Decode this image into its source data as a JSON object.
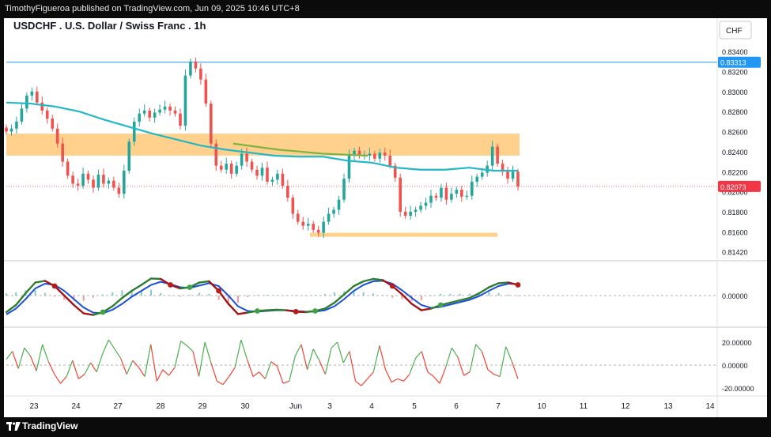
{
  "publisher_line": "TimothyFigueroa published on TradingView.com, Jun 09, 2025 10:46 UTC+8",
  "chart_title": "USDCHF . U.S. Dollar / Swiss Franc . 1h",
  "currency_button": "CHF",
  "brand": "TradingView",
  "colors": {
    "background": "#ffffff",
    "up_candle": "#26a69a",
    "down_candle": "#ef5350",
    "moving_average_teal": "#22b8c8",
    "moving_average_green": "#7cb342",
    "zone_fill": "#ffcc80",
    "horizontal_line": "#2196f3",
    "current_price_tag": "#f23645",
    "level_tag": "#2196f3",
    "fast_line": "#2e7d32",
    "slow_line": "#1e4fd8",
    "bearish_line": "#a31515",
    "oscillator_up": "#4caf50",
    "oscillator_down": "#f44336"
  },
  "chart_data": [
    {
      "type": "candlestick",
      "panel": "price",
      "title": "USDCHF . U.S. Dollar / Swiss Franc . 1h",
      "x": [
        "23",
        "24",
        "27",
        "28",
        "29",
        "30",
        "Jun",
        "3",
        "4",
        "5",
        "6",
        "7",
        "10",
        "11",
        "12",
        "13",
        "14"
      ],
      "y_ticks": [
        0.8342,
        0.8322,
        0.8302,
        0.8282,
        0.8262,
        0.8242,
        0.8222,
        0.8202,
        0.8182,
        0.8162,
        0.8142
      ],
      "y_tick_labels": [
        "0.83400",
        "0.83200",
        "0.83000",
        "0.82800",
        "0.82600",
        "0.82400",
        "0.82200",
        "0.82000",
        "0.81800",
        "0.81600",
        "0.81420"
      ],
      "ylim": [
        0.8137,
        0.835
      ],
      "close_path": [
        0.8262,
        0.8265,
        0.8272,
        0.8285,
        0.8298,
        0.8302,
        0.8291,
        0.8283,
        0.8275,
        0.8265,
        0.825,
        0.8232,
        0.8218,
        0.821,
        0.8208,
        0.822,
        0.8214,
        0.8206,
        0.8219,
        0.821,
        0.8213,
        0.8206,
        0.82,
        0.8223,
        0.8252,
        0.8272,
        0.828,
        0.8283,
        0.8276,
        0.8281,
        0.8284,
        0.8287,
        0.8283,
        0.828,
        0.8268,
        0.8318,
        0.8332,
        0.8325,
        0.8314,
        0.829,
        0.825,
        0.8228,
        0.8224,
        0.823,
        0.822,
        0.8228,
        0.824,
        0.8232,
        0.8224,
        0.8218,
        0.8226,
        0.8212,
        0.8214,
        0.822,
        0.8208,
        0.8196,
        0.818,
        0.8172,
        0.8168,
        0.817,
        0.8164,
        0.8161,
        0.8172,
        0.818,
        0.8184,
        0.8194,
        0.8215,
        0.8238,
        0.8243,
        0.8238,
        0.8238,
        0.824,
        0.8235,
        0.8241,
        0.8238,
        0.8228,
        0.8216,
        0.8182,
        0.8178,
        0.8182,
        0.8184,
        0.8188,
        0.8191,
        0.8198,
        0.8196,
        0.8206,
        0.8194,
        0.82,
        0.8204,
        0.8197,
        0.8198,
        0.8212,
        0.8217,
        0.8221,
        0.8228,
        0.8247,
        0.823,
        0.8222,
        0.8215,
        0.8222,
        0.8207
      ],
      "zones": [
        {
          "low": 0.8238,
          "high": 0.826
        },
        {
          "low": 0.8157,
          "high": 0.8161
        }
      ],
      "horizontal_line": 0.83313,
      "level_tag": "0.83313",
      "current_price": 0.82073,
      "current_price_tag": "0.82073",
      "ma_teal": [
        0.8291,
        0.829,
        0.8287,
        0.8282,
        0.8274,
        0.8267,
        0.826,
        0.8254,
        0.8248,
        0.8244,
        0.8241,
        0.8238,
        0.8237,
        0.8237,
        0.8233,
        0.8231,
        0.8226,
        0.8224,
        0.8224,
        0.8226,
        0.8223,
        0.8223
      ],
      "ma_green_segment": [
        0.825,
        0.8244,
        0.824,
        0.8238
      ]
    },
    {
      "type": "line",
      "panel": "momentum",
      "y_tick_labels": [
        "0.00000"
      ],
      "ylim": [
        -1,
        1
      ],
      "series": [
        {
          "values": [
            -0.7,
            -0.4,
            0.1,
            0.55,
            0.62,
            0.4,
            0.0,
            -0.4,
            -0.75,
            -0.82,
            -0.7,
            -0.45,
            -0.1,
            0.2,
            0.45,
            0.72,
            0.7,
            0.45,
            0.3,
            0.35,
            0.55,
            0.6,
            0.2,
            -0.35,
            -0.78,
            -0.72,
            -0.65,
            -0.62,
            -0.6,
            -0.62,
            -0.68,
            -0.7,
            -0.65,
            -0.55,
            -0.3,
            0.05,
            0.4,
            0.6,
            0.7,
            0.65,
            0.4,
            0.05,
            -0.35,
            -0.62,
            -0.55,
            -0.4,
            -0.3,
            -0.2,
            -0.1,
            0.1,
            0.35,
            0.52,
            0.55,
            0.45
          ]
        },
        {
          "values": [
            -0.8,
            -0.55,
            -0.15,
            0.3,
            0.5,
            0.45,
            0.2,
            -0.15,
            -0.5,
            -0.72,
            -0.75,
            -0.6,
            -0.35,
            -0.05,
            0.2,
            0.45,
            0.58,
            0.48,
            0.35,
            0.32,
            0.42,
            0.52,
            0.4,
            0.0,
            -0.45,
            -0.65,
            -0.68,
            -0.65,
            -0.62,
            -0.62,
            -0.65,
            -0.68,
            -0.68,
            -0.62,
            -0.45,
            -0.15,
            0.2,
            0.45,
            0.6,
            0.62,
            0.5,
            0.22,
            -0.1,
            -0.4,
            -0.52,
            -0.48,
            -0.38,
            -0.28,
            -0.18,
            -0.02,
            0.2,
            0.4,
            0.5,
            0.48
          ]
        }
      ]
    },
    {
      "type": "line",
      "panel": "oscillator",
      "y_tick_labels": [
        "20.00000",
        "0.00000",
        "-20.00000"
      ],
      "ylim": [
        -25,
        25
      ],
      "series": [
        {
          "values": [
            5,
            12,
            -3,
            15,
            8,
            -5,
            18,
            3,
            -8,
            -16,
            -10,
            4,
            -12,
            -8,
            2,
            -6,
            10,
            22,
            14,
            6,
            -8,
            4,
            -2,
            -10,
            18,
            -14,
            -4,
            -9,
            -2,
            21,
            17,
            12,
            -10,
            20,
            2,
            -14,
            -17,
            -10,
            -2,
            22,
            5,
            -10,
            -6,
            -12,
            3,
            -1,
            -16,
            -14,
            8,
            18,
            -4,
            14,
            4,
            -8,
            15,
            20,
            2,
            12,
            -14,
            -18,
            -12,
            -6,
            17,
            -4,
            -15,
            -12,
            -14,
            -8,
            6,
            12,
            -6,
            -10,
            -16,
            -2,
            15,
            7,
            -9,
            -6,
            18,
            12,
            -4,
            -8,
            -10,
            16,
            3,
            -12
          ]
        }
      ]
    }
  ]
}
